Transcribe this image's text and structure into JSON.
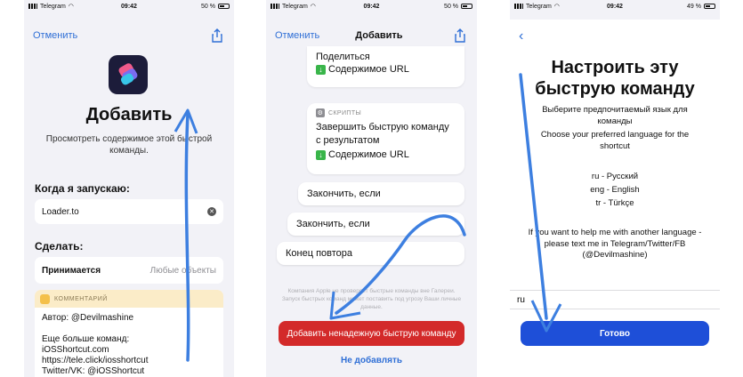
{
  "status": {
    "carrier": "Telegram",
    "time": "09:42",
    "battery_p1": "50 %",
    "battery_p2": "50 %",
    "battery_p3": "49 %"
  },
  "panel1": {
    "cancel": "Отменить",
    "title": "Добавить",
    "subtitle": "Просмотреть содержимое этой быстрой команды.",
    "when_label": "Когда я запускаю:",
    "input_value": "Loader.to",
    "do_label": "Сделать:",
    "accepts_label": "Принимается",
    "accepts_value": "Любые объекты",
    "comment_header": "КОММЕНТАРИЙ",
    "comment_body": "Автор: @Devilmashine\n\nЕще больше команд:\niOSShortcut.com\nhttps://tele.click/iosshortcut\nTwitter/VK: @iOSShortcut"
  },
  "panel2": {
    "cancel": "Отменить",
    "title": "Добавить",
    "share_action": "Поделиться",
    "url_badge": "Содержимое URL",
    "scripts_header": "СКРИПТЫ",
    "finish_action": "Завершить быструю команду с результатом",
    "url_badge2": "Содержимое URL",
    "end_if_1": "Закончить, если",
    "end_if_2": "Закончить, если",
    "end_repeat": "Конец повтора",
    "disclaimer": "Компания Apple не проверяет быстрые команды вне Галереи. Запуск быстрых команд может поставить под угрозу Ваши личные данные.",
    "add_untrusted": "Добавить ненадежную быструю команду",
    "dont_add": "Не добавлять"
  },
  "panel3": {
    "title": "Настроить эту быструю команду",
    "prompt_ru": "Выберите предпочитаемый язык для команды",
    "prompt_en": "Choose your preferred language for the shortcut",
    "lang_ru": "ru - Русский",
    "lang_en": "eng - English",
    "lang_tr": "tr - Türkçe",
    "help_text": "If you want to help me with another language - please text me in Telegram/Twitter/FB (@Devilmashine)",
    "input_value": "ru",
    "done": "Готово"
  },
  "colors": {
    "ios_blue": "#2f6fd6",
    "annotation_arrow": "#3d7fe0",
    "danger": "#d32a2a",
    "done_button": "#1e4fd8"
  }
}
